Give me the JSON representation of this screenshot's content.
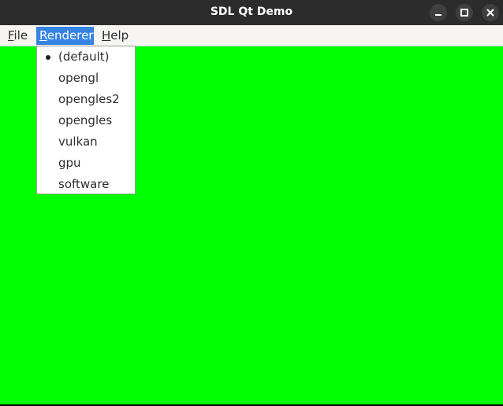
{
  "window": {
    "title": "SDL Qt Demo",
    "canvas_color": "#00ff00",
    "titlebar_buttons": [
      "minimize-icon",
      "maximize-icon",
      "close-icon"
    ]
  },
  "menubar": {
    "file": {
      "mnemonic": "F",
      "rest": "ile"
    },
    "renderer": {
      "mnemonic": "R",
      "rest": "enderer"
    },
    "help": {
      "mnemonic": "H",
      "rest": "elp"
    }
  },
  "renderer_menu": {
    "selected": "(default)",
    "items": [
      "(default)",
      "opengl",
      "opengles2",
      "opengles",
      "vulkan",
      "gpu",
      "software"
    ]
  }
}
